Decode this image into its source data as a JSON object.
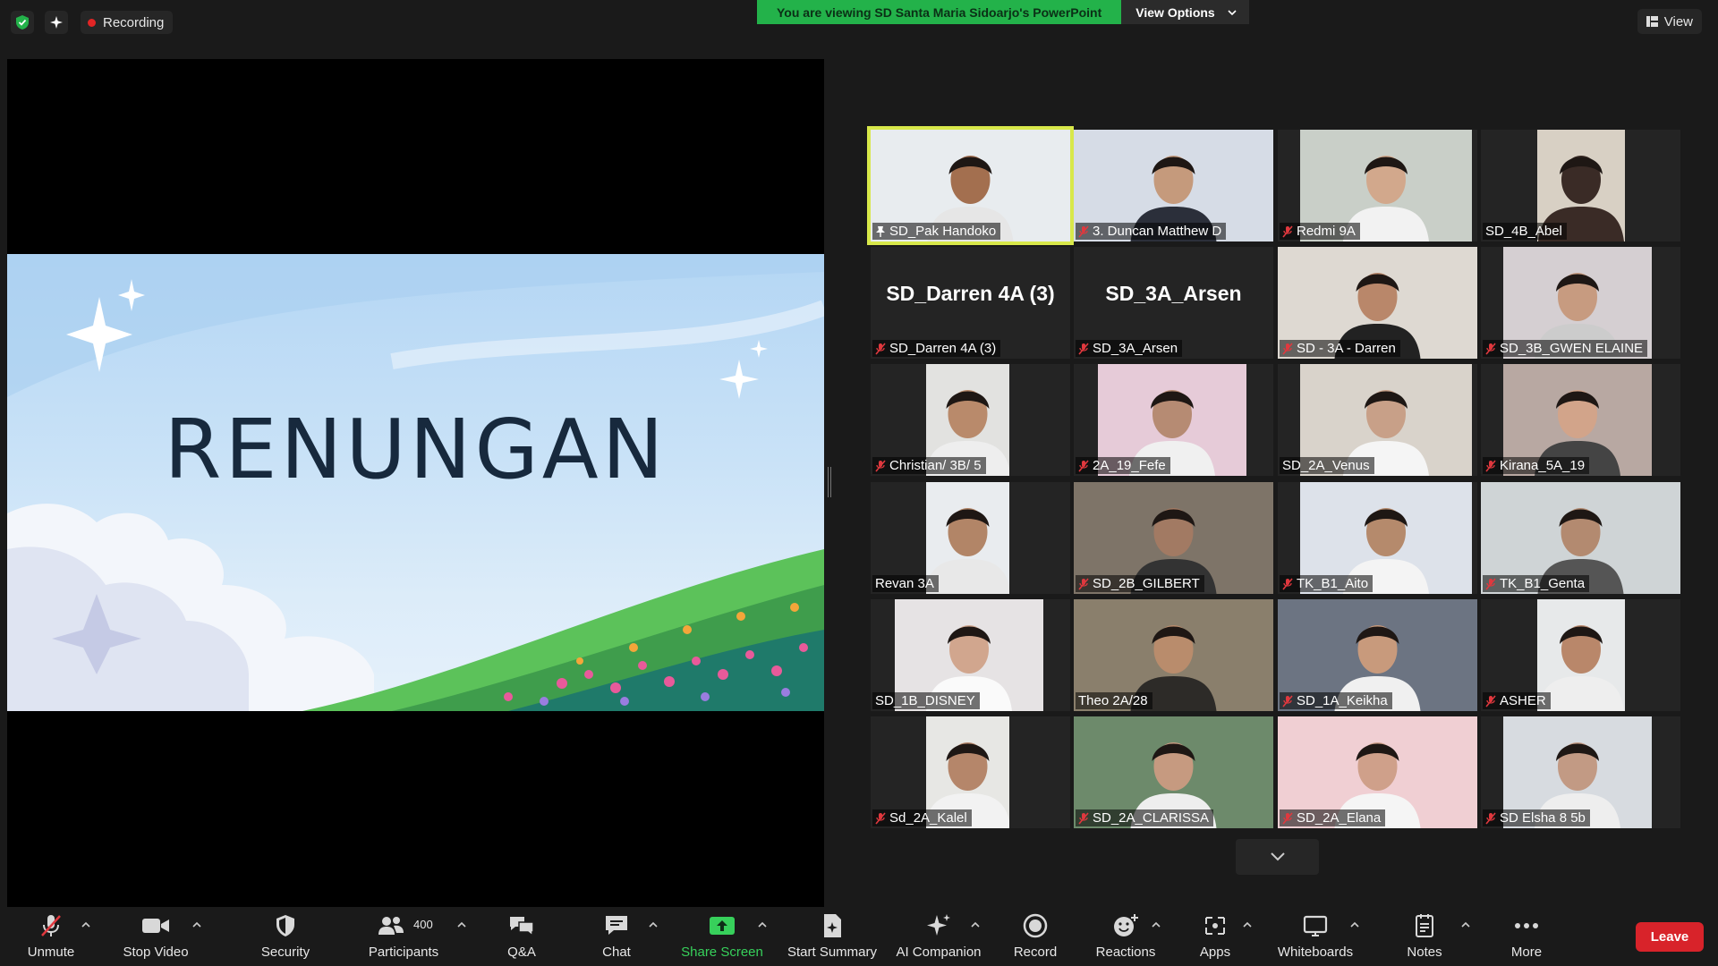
{
  "top_bar": {
    "recording_label": "Recording",
    "viewing_banner": "You are viewing SD Santa Maria Sidoarjo's PowerPoint",
    "view_options_label": "View Options",
    "view_label": "View"
  },
  "shared_content": {
    "slide_title": "RENUNGAN"
  },
  "participants": [
    {
      "name": "SD_Pak Handoko",
      "muted": false,
      "pinned": true,
      "active_speaker": true
    },
    {
      "name": "3. Duncan Matthew D",
      "muted": true
    },
    {
      "name": "Redmi 9A",
      "muted": true
    },
    {
      "name": "SD_4B_Abel",
      "muted": false
    },
    {
      "name": "SD_Darren 4A (3)",
      "muted": true,
      "video_off": true,
      "display_name": "SD_Darren 4A (3)"
    },
    {
      "name": "SD_3A_Arsen",
      "muted": true,
      "video_off": true,
      "display_name": "SD_3A_Arsen"
    },
    {
      "name": "SD - 3A - Darren",
      "muted": true
    },
    {
      "name": "SD_3B_GWEN ELAINE",
      "muted": true
    },
    {
      "name": "Christian/ 3B/ 5",
      "muted": true
    },
    {
      "name": "2A_19_Fefe",
      "muted": true
    },
    {
      "name": "SD_2A_Venus",
      "muted": false
    },
    {
      "name": "Kirana_5A_19",
      "muted": true
    },
    {
      "name": "Revan 3A",
      "muted": false
    },
    {
      "name": "SD_2B_GILBERT",
      "muted": true
    },
    {
      "name": "TK_B1_Aito",
      "muted": true
    },
    {
      "name": "TK_B1_Genta",
      "muted": true
    },
    {
      "name": "SD_1B_DISNEY",
      "muted": false
    },
    {
      "name": "Theo 2A/28",
      "muted": false
    },
    {
      "name": "SD_1A_Keikha",
      "muted": true
    },
    {
      "name": "ASHER",
      "muted": true
    },
    {
      "name": "Sd_2A_Kalel",
      "muted": true
    },
    {
      "name": "SD_2A_CLARISSA",
      "muted": true
    },
    {
      "name": "SD_2A_Elana",
      "muted": true
    },
    {
      "name": "SD Elsha 8 5b",
      "muted": true
    }
  ],
  "toolbar": {
    "unmute": "Unmute",
    "stop_video": "Stop Video",
    "security": "Security",
    "participants": "Participants",
    "participants_count": "400",
    "qa": "Q&A",
    "chat": "Chat",
    "share_screen": "Share Screen",
    "start_summary": "Start Summary",
    "ai_companion": "AI Companion",
    "record": "Record",
    "reactions": "Reactions",
    "apps": "Apps",
    "whiteboards": "Whiteboards",
    "notes": "Notes",
    "more": "More",
    "leave": "Leave"
  },
  "colors": {
    "banner_green": "#23b24a",
    "active_speaker_border": "#d8e84a",
    "leave_red": "#d8232a",
    "share_green": "#37d05b",
    "muted_red": "#e0383e"
  }
}
